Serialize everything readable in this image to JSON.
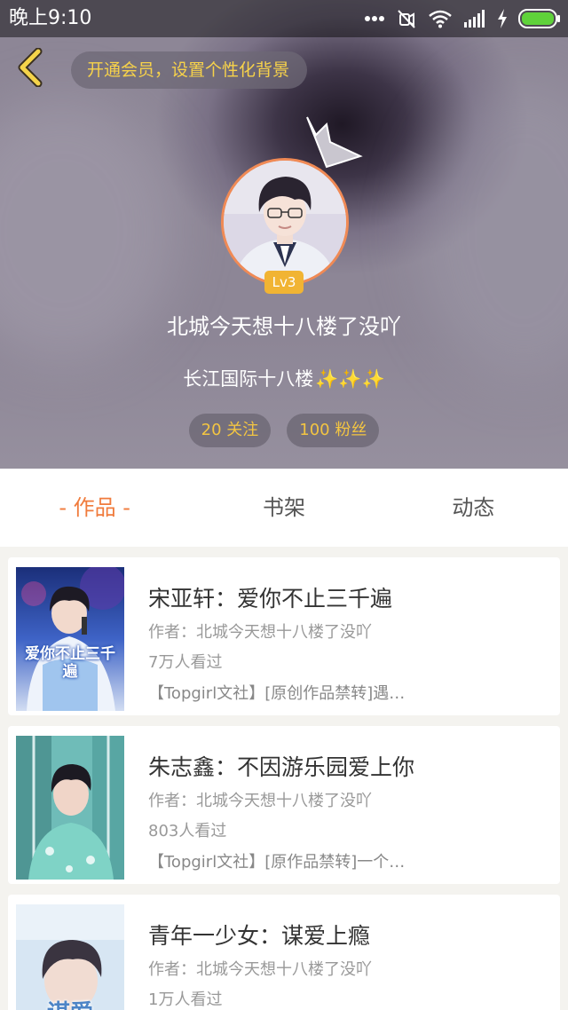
{
  "status_bar": {
    "time": "晚上9:10",
    "icons": [
      "more-dots-icon",
      "mute-icon",
      "wifi-icon",
      "signal-icon",
      "charging-icon",
      "battery-icon"
    ]
  },
  "header": {
    "back_icon": "chevron-left-icon",
    "vip_banner": "开通会员，设置个性化背景"
  },
  "profile": {
    "level": "Lv3",
    "username": "北城今天想十八楼了没吖",
    "signature": "长江国际十八楼",
    "signature_emoji": "✨✨✨",
    "following": "20 关注",
    "followers": "100 粉丝"
  },
  "tabs": [
    {
      "label": "- 作品 -",
      "active": true
    },
    {
      "label": "书架",
      "active": false
    },
    {
      "label": "动态",
      "active": false
    }
  ],
  "works": [
    {
      "title": "宋亚轩：爱你不止三千遍",
      "author": "作者：北城今天想十八楼了没吖",
      "views": "7万人看过",
      "tags": "【Topgirl文社】[原创作品禁转]遇…",
      "cover_text": "爱你不止三千遍"
    },
    {
      "title": "朱志鑫：不因游乐园爱上你",
      "author": "作者：北城今天想十八楼了没吖",
      "views": "803人看过",
      "tags": "【Topgirl文社】[原作品禁转]一个…"
    },
    {
      "title": "青年一少女：谋爱上瘾",
      "author": "作者：北城今天想十八楼了没吖",
      "views": "1万人看过",
      "tags": "",
      "cover_text": "谋爱"
    }
  ],
  "colors": {
    "accent": "#f07b3c",
    "vip_text": "#f7d24a",
    "level_badge": "#f1b433",
    "avatar_border": "#f08a55",
    "battery_green": "#5fd23a"
  }
}
